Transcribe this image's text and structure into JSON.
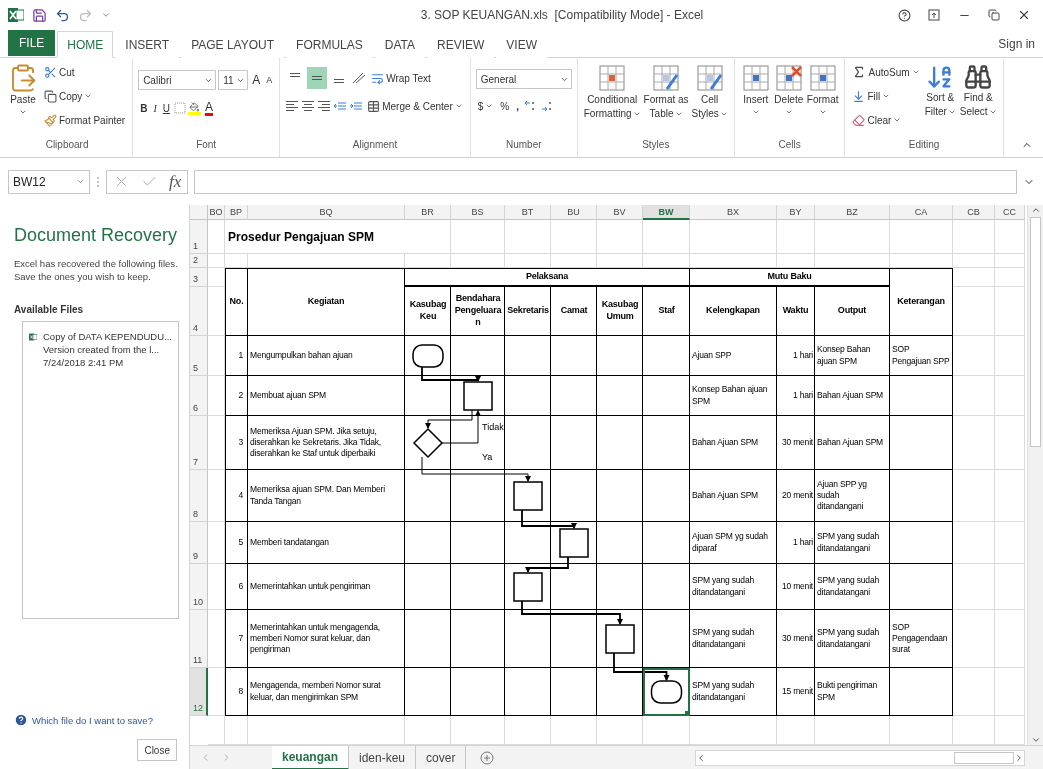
{
  "window": {
    "title": "3. SOP KEUANGAN.xls  [Compatibility Mode] - Excel",
    "sign_in": "Sign in"
  },
  "ribbon": {
    "file_tab": "FILE",
    "tabs": [
      {
        "label": "HOME",
        "selected": true
      },
      {
        "label": "INSERT",
        "selected": false
      },
      {
        "label": "PAGE LAYOUT",
        "selected": false
      },
      {
        "label": "FORMULAS",
        "selected": false
      },
      {
        "label": "DATA",
        "selected": false
      },
      {
        "label": "REVIEW",
        "selected": false
      },
      {
        "label": "VIEW",
        "selected": false
      }
    ],
    "clipboard": {
      "label": "Clipboard",
      "paste": "Paste",
      "cut": "Cut",
      "copy": "Copy",
      "format_painter": "Format Painter"
    },
    "font": {
      "label": "Font",
      "name": "Calibri",
      "size": "11",
      "grow": "A",
      "shrink": "A",
      "bold": "B",
      "italic": "I",
      "underline": "U",
      "font_color_letter": "A"
    },
    "alignment": {
      "label": "Alignment",
      "vertical": [
        {
          "selected": false
        },
        {
          "selected": true
        },
        {
          "selected": false
        }
      ],
      "wrap_text": "Wrap Text",
      "merge_center": "Merge & Center"
    },
    "number": {
      "label": "Number",
      "format": "General",
      "currency": "$",
      "percent": "%",
      "comma": ","
    },
    "styles": {
      "label": "Styles",
      "buttons": [
        {
          "lines": [
            "Conditional",
            "Formatting"
          ]
        },
        {
          "lines": [
            "Format as",
            "Table"
          ]
        },
        {
          "lines": [
            "Cell",
            "Styles"
          ]
        }
      ]
    },
    "cells": {
      "label": "Cells",
      "buttons": [
        "Insert",
        "Delete",
        "Format"
      ]
    },
    "editing": {
      "label": "Editing",
      "autosum": "AutoSum",
      "fill": "Fill",
      "clear": "Clear",
      "sort": [
        "Sort &",
        "Filter"
      ],
      "find": [
        "Find &",
        "Select"
      ]
    }
  },
  "formula_bar": {
    "name_box": "BW12",
    "fx": "fx"
  },
  "recovery": {
    "title": "Document Recovery",
    "description": "Excel has recovered the following files. Save the ones you wish to keep.",
    "files_label": "Available Files",
    "files": [
      {
        "name": "Copy of DATA KEPENDUDU...",
        "version": "Version created from the l...",
        "date": "7/24/2018 2:41 PM"
      }
    ],
    "help_link": "Which file do I want to save?",
    "close": "Close"
  },
  "sheet": {
    "columns": [
      {
        "label": "BO",
        "selected": false
      },
      {
        "label": "BP",
        "selected": false
      },
      {
        "label": "BQ",
        "selected": false
      },
      {
        "label": "BR",
        "selected": false
      },
      {
        "label": "BS",
        "selected": false
      },
      {
        "label": "BT",
        "selected": false
      },
      {
        "label": "BU",
        "selected": false
      },
      {
        "label": "BV",
        "selected": false
      },
      {
        "label": "BW",
        "selected": true
      },
      {
        "label": "BX",
        "selected": false
      },
      {
        "label": "BY",
        "selected": false
      },
      {
        "label": "BZ",
        "selected": false
      },
      {
        "label": "CA",
        "selected": false
      },
      {
        "label": "CB",
        "selected": false
      },
      {
        "label": "CC",
        "selected": false
      }
    ],
    "rows": [
      {
        "label": "1",
        "selected": false
      },
      {
        "label": "2",
        "selected": false
      },
      {
        "label": "3",
        "selected": false
      },
      {
        "label": "4",
        "selected": false
      },
      {
        "label": "5",
        "selected": false
      },
      {
        "label": "6",
        "selected": false
      },
      {
        "label": "7",
        "selected": false
      },
      {
        "label": "8",
        "selected": false
      },
      {
        "label": "9",
        "selected": false
      },
      {
        "label": "10",
        "selected": false
      },
      {
        "label": "11",
        "selected": false
      },
      {
        "label": "12",
        "selected": true
      }
    ],
    "title": "Prosedur Pengajuan SPM",
    "table": {
      "no_header": "No.",
      "activity_header": "Kegiatan",
      "lanes_header": "Pelaksana",
      "lanes": [
        "Kasubag Keu",
        "Bendahara Pengeluaran",
        "Sekretaris",
        "Camat",
        "Kasubag Umum",
        "Staf"
      ],
      "quality_header": "Mutu Baku",
      "quality_columns": [
        "Kelengkapan",
        "Waktu",
        "Output"
      ],
      "notes_header": "Keterangan",
      "rows": [
        {
          "no": "1",
          "activity": "Mengumpulkan bahan ajuan",
          "lane_cells": [
            {
              "kind": "terminator"
            },
            {
              "kind": "empty"
            },
            {
              "kind": "empty"
            },
            {
              "kind": "empty"
            },
            {
              "kind": "empty"
            },
            {
              "kind": "empty"
            }
          ],
          "kelengkapan": "Ajuan SPP",
          "waktu": "1 hari",
          "output": "Konsep Bahan ajuan SPM",
          "keterangan": "SOP Pengajuan SPP"
        },
        {
          "no": "2",
          "activity": "Membuat ajuan SPM",
          "lane_cells": [
            {
              "kind": "empty"
            },
            {
              "kind": "process"
            },
            {
              "kind": "empty"
            },
            {
              "kind": "empty"
            },
            {
              "kind": "empty"
            },
            {
              "kind": "empty"
            }
          ],
          "kelengkapan": "Konsep Bahan ajuan SPM",
          "waktu": "1 hari",
          "output": "Bahan Ajuan SPM"
        },
        {
          "no": "3",
          "activity": "Memeriksa Ajuan SPM. Jika setuju, diserahkan ke Sekretaris. Jika Tidak, diserahkan ke Staf untuk diperbaiki",
          "lane_cells": [
            {
              "kind": "decision",
              "no_label": "Tidak",
              "yes_label": "Ya"
            },
            {
              "kind": "empty"
            },
            {
              "kind": "empty"
            },
            {
              "kind": "empty"
            },
            {
              "kind": "empty"
            },
            {
              "kind": "empty"
            }
          ],
          "kelengkapan": "Bahan Ajuan SPM",
          "waktu": "30 menit",
          "output": "Bahan Ajuan SPM"
        },
        {
          "no": "4",
          "activity": "Memeriksa ajuan SPM. Dan Memberi Tanda Tangan",
          "lane_cells": [
            {
              "kind": "empty"
            },
            {
              "kind": "empty"
            },
            {
              "kind": "process"
            },
            {
              "kind": "empty"
            },
            {
              "kind": "empty"
            },
            {
              "kind": "empty"
            }
          ],
          "kelengkapan": "Bahan Ajuan SPM",
          "waktu": "20 menit",
          "output": "Ajuan SPP yg sudah ditandangani"
        },
        {
          "no": "5",
          "activity": "Memberi tandatangan",
          "lane_cells": [
            {
              "kind": "empty"
            },
            {
              "kind": "empty"
            },
            {
              "kind": "empty"
            },
            {
              "kind": "process"
            },
            {
              "kind": "empty"
            },
            {
              "kind": "empty"
            }
          ],
          "kelengkapan": "Ajuan SPM yg sudah diparaf",
          "waktu": "1 hari",
          "output": "SPM yang sudah ditandatangani"
        },
        {
          "no": "6",
          "activity": "Memerintahkan untuk pengiriman",
          "lane_cells": [
            {
              "kind": "empty"
            },
            {
              "kind": "empty"
            },
            {
              "kind": "process"
            },
            {
              "kind": "empty"
            },
            {
              "kind": "empty"
            },
            {
              "kind": "empty"
            }
          ],
          "kelengkapan": "SPM yang sudah ditandatangani",
          "waktu": "10 menit",
          "output": "SPM yang sudah ditandatangani"
        },
        {
          "no": "7",
          "activity": "Memerintahkan untuk mengagenda, memberi Nomor surat keluar, dan pengiriman",
          "lane_cells": [
            {
              "kind": "empty"
            },
            {
              "kind": "empty"
            },
            {
              "kind": "empty"
            },
            {
              "kind": "empty"
            },
            {
              "kind": "process"
            },
            {
              "kind": "empty"
            }
          ],
          "kelengkapan": "SPM yang sudah ditandatangani",
          "waktu": "30 menit",
          "output": "SPM yang sudah ditandatangani",
          "keterangan": "SOP Pengagendaan surat"
        },
        {
          "no": "8",
          "activity": "Mengagenda, memberi Nomor surat keluar, dan mengirimkan SPM",
          "lane_cells": [
            {
              "kind": "empty"
            },
            {
              "kind": "empty"
            },
            {
              "kind": "empty"
            },
            {
              "kind": "empty"
            },
            {
              "kind": "empty"
            },
            {
              "kind": "terminator"
            }
          ],
          "kelengkapan": "SPM yang sudah ditandatangani",
          "waktu": "15 menit",
          "output": "Bukti pengiriman SPM"
        }
      ]
    }
  },
  "sheet_tabs": [
    {
      "label": "keuangan",
      "selected": true
    },
    {
      "label": "iden-keu",
      "selected": false
    },
    {
      "label": "cover",
      "selected": false
    }
  ]
}
